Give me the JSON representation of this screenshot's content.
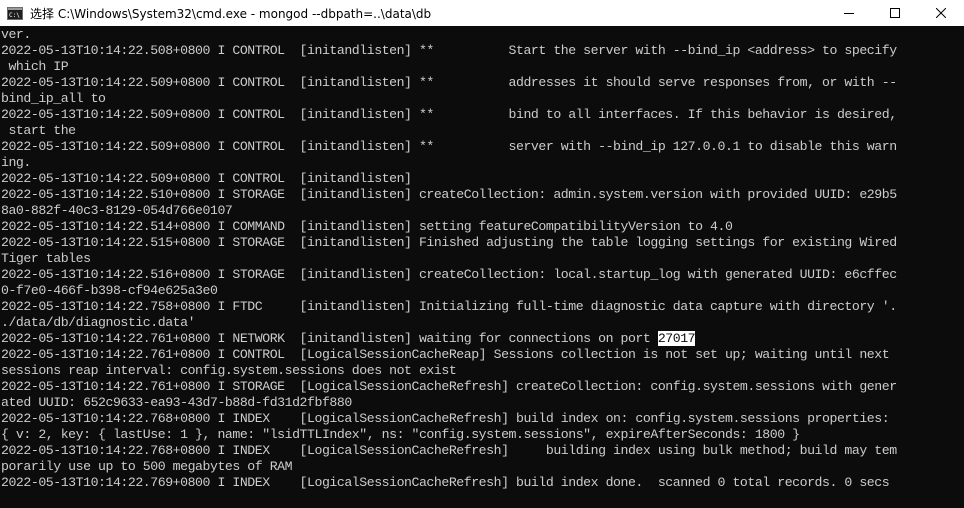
{
  "window": {
    "title": "选择 C:\\Windows\\System32\\cmd.exe - mongod  --dbpath=..\\data\\db",
    "icon": "cmd-icon",
    "controls": [
      "minimize-icon",
      "maximize-icon",
      "close-icon"
    ]
  },
  "terminal": {
    "lines": [
      "ver.",
      "2022-05-13T10:14:22.508+0800 I CONTROL  [initandlisten] **          Start the server with --bind_ip <address> to specify",
      " which IP",
      "2022-05-13T10:14:22.509+0800 I CONTROL  [initandlisten] **          addresses it should serve responses from, or with --",
      "bind_ip_all to",
      "2022-05-13T10:14:22.509+0800 I CONTROL  [initandlisten] **          bind to all interfaces. If this behavior is desired,",
      " start the",
      "2022-05-13T10:14:22.509+0800 I CONTROL  [initandlisten] **          server with --bind_ip 127.0.0.1 to disable this warn",
      "ing.",
      "2022-05-13T10:14:22.509+0800 I CONTROL  [initandlisten]",
      "2022-05-13T10:14:22.510+0800 I STORAGE  [initandlisten] createCollection: admin.system.version with provided UUID: e29b5",
      "8a0-882f-40c3-8129-054d766e0107",
      "2022-05-13T10:14:22.514+0800 I COMMAND  [initandlisten] setting featureCompatibilityVersion to 4.0",
      "2022-05-13T10:14:22.515+0800 I STORAGE  [initandlisten] Finished adjusting the table logging settings for existing Wired",
      "Tiger tables",
      "2022-05-13T10:14:22.516+0800 I STORAGE  [initandlisten] createCollection: local.startup_log with generated UUID: e6cffec",
      "0-f7e0-466f-b398-cf94e625a3e0",
      "2022-05-13T10:14:22.758+0800 I FTDC     [initandlisten] Initializing full-time diagnostic data capture with directory '.",
      "./data/db/diagnostic.data'",
      "2022-05-13T10:14:22.761+0800 I NETWORK  [initandlisten] waiting for connections on port ",
      "2022-05-13T10:14:22.761+0800 I CONTROL  [LogicalSessionCacheReap] Sessions collection is not set up; waiting until next",
      "sessions reap interval: config.system.sessions does not exist",
      "2022-05-13T10:14:22.761+0800 I STORAGE  [LogicalSessionCacheRefresh] createCollection: config.system.sessions with gener",
      "ated UUID: 652c9633-ea93-43d7-b88d-fd31d2fbf880",
      "2022-05-13T10:14:22.768+0800 I INDEX    [LogicalSessionCacheRefresh] build index on: config.system.sessions properties:",
      "{ v: 2, key: { lastUse: 1 }, name: \"lsidTTLIndex\", ns: \"config.system.sessions\", expireAfterSeconds: 1800 }",
      "2022-05-13T10:14:22.768+0800 I INDEX    [LogicalSessionCacheRefresh]     building index using bulk method; build may tem",
      "porarily use up to 500 megabytes of RAM",
      "2022-05-13T10:14:22.769+0800 I INDEX    [LogicalSessionCacheRefresh] build index done.  scanned 0 total records. 0 secs"
    ],
    "selected_text": "27017",
    "selected_line_index": 19,
    "colors": {
      "background": "#0c0c0c",
      "foreground": "#cccccc",
      "selection_bg": "#ffffff",
      "selection_fg": "#0c0c0c"
    }
  }
}
